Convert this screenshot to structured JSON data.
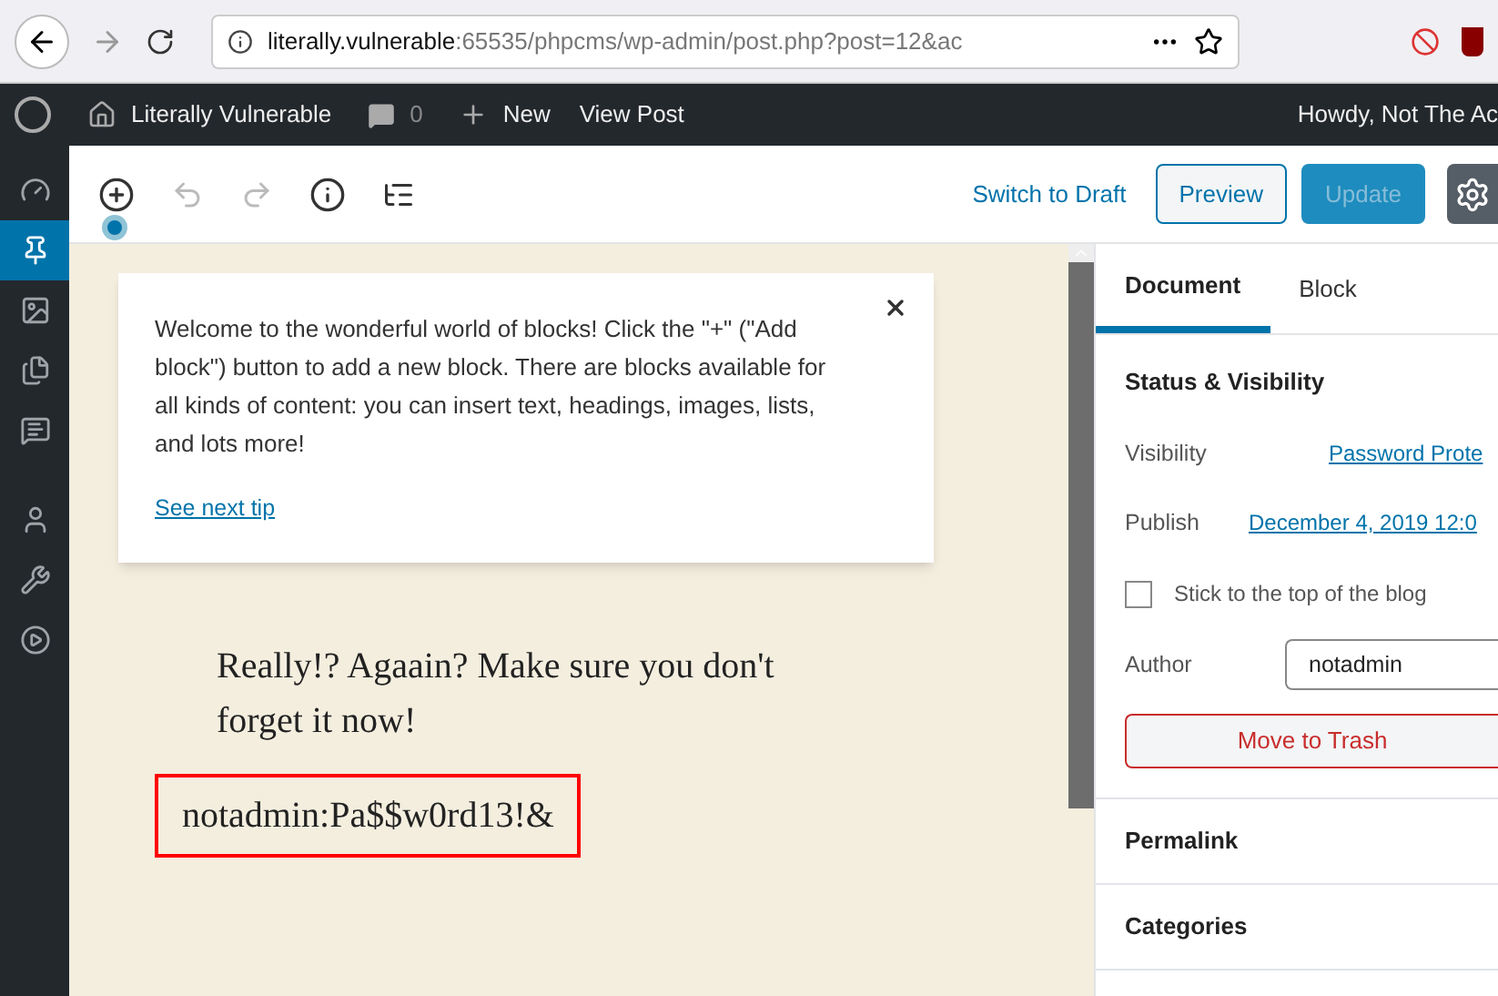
{
  "browser": {
    "url_host": "literally.vulnerable",
    "url_path": ":65535/phpcms/wp-admin/post.php?post=12&ac"
  },
  "admin_bar": {
    "site": "Literally Vulnerable",
    "comments": "0",
    "new": "New",
    "view": "View Post",
    "greeting": "Howdy, Not The Ac"
  },
  "sidebar": {
    "items": [
      {
        "kind": "dashboard",
        "selected": false
      },
      {
        "kind": "posts",
        "selected": true
      },
      {
        "kind": "media",
        "selected": false
      },
      {
        "kind": "pages",
        "selected": false
      },
      {
        "kind": "comments",
        "selected": false
      },
      {
        "kind": "users",
        "selected": false
      },
      {
        "kind": "tools",
        "selected": false
      },
      {
        "kind": "plugins",
        "selected": false
      }
    ]
  },
  "toolbar": {
    "switch": "Switch to Draft",
    "preview": "Preview",
    "update": {
      "label": "Update",
      "disabled": true
    }
  },
  "tip": {
    "text": "Welcome to the wonderful world of blocks! Click the \"+\" (\"Add block\") button to add a new block. There are blocks available for all kinds of content: you can insert text, headings, images, lists, and lots more!",
    "link": "See next tip"
  },
  "content": {
    "blocks": [
      {
        "text": "Really!? Agaain? Make sure you don't forget it now!",
        "highlighted": false
      },
      {
        "text": "notadmin:Pa$$w0rd13!&",
        "highlighted": true
      }
    ]
  },
  "settings": {
    "tabs": [
      {
        "label": "Document",
        "selected": true
      },
      {
        "label": "Block",
        "selected": false
      }
    ],
    "panel_title": "Status & Visibility",
    "rows": [
      {
        "label": "Visibility",
        "value": "Password Prote"
      },
      {
        "label": "Publish",
        "value": "December 4, 2019 12:0"
      }
    ],
    "sticky": {
      "label": "Stick to the top of the blog",
      "checked": false
    },
    "author": {
      "label": "Author",
      "value": "notadmin"
    },
    "trash": "Move to Trash",
    "sections": [
      "Permalink",
      "Categories"
    ]
  }
}
